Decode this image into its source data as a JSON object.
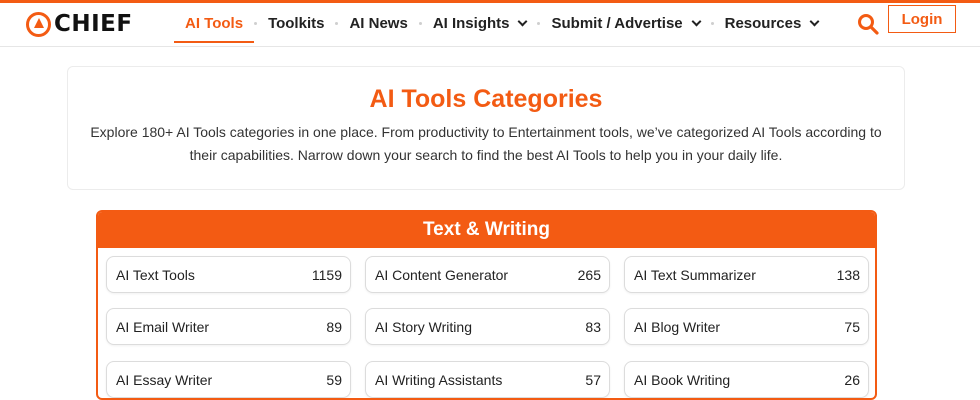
{
  "brand": {
    "name": "CHIEF",
    "accent": "#f35b13"
  },
  "nav": {
    "items": [
      {
        "label": "AI Tools",
        "active": true,
        "dropdown": false
      },
      {
        "label": "Toolkits",
        "active": false,
        "dropdown": false
      },
      {
        "label": "AI News",
        "active": false,
        "dropdown": false
      },
      {
        "label": "AI Insights",
        "active": false,
        "dropdown": true
      },
      {
        "label": "Submit / Advertise",
        "active": false,
        "dropdown": true
      },
      {
        "label": "Resources",
        "active": false,
        "dropdown": true
      }
    ],
    "search_icon": "search-icon",
    "login_label": "Login"
  },
  "intro": {
    "title": "AI Tools Categories",
    "description": "Explore 180+ AI Tools categories in one place. From productivity to Entertainment tools, we’ve categorized AI Tools according to their capabilities.  Narrow down your search to find the best AI Tools to help you in your daily life."
  },
  "category": {
    "title": "Text & Writing",
    "items": [
      {
        "label": "AI Text Tools",
        "count": "1159"
      },
      {
        "label": "AI Content Generator",
        "count": "265"
      },
      {
        "label": "AI Text Summarizer",
        "count": "138"
      },
      {
        "label": "AI Email Writer",
        "count": "89"
      },
      {
        "label": "AI Story Writing",
        "count": "83"
      },
      {
        "label": "AI Blog Writer",
        "count": "75"
      },
      {
        "label": "AI Essay Writer",
        "count": "59"
      },
      {
        "label": "AI Writing Assistants",
        "count": "57"
      },
      {
        "label": "AI Book Writing",
        "count": "26"
      }
    ]
  }
}
